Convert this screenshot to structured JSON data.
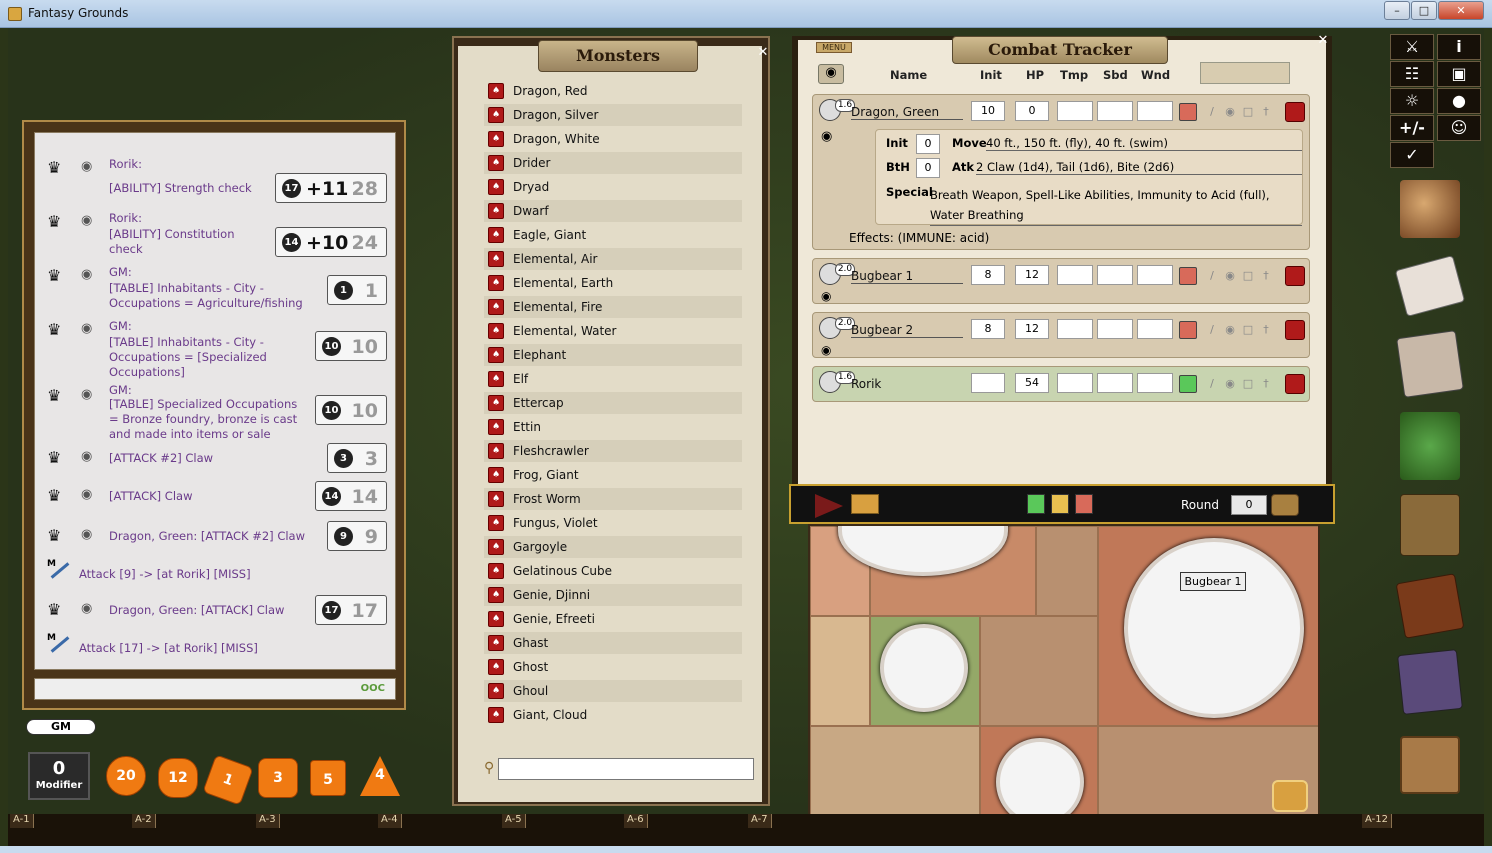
{
  "window": {
    "title": "Fantasy Grounds",
    "btn_min": "–",
    "btn_max": "□",
    "btn_close": "✕"
  },
  "grid_labels": [
    "A-1",
    "A-2",
    "A-3",
    "A-4",
    "A-5",
    "A-6",
    "A-7",
    "A-12"
  ],
  "chat": {
    "messages": [
      {
        "sender": "Rorik:",
        "text": "[ABILITY] Strength check",
        "die": "17",
        "total": "+11",
        "result": "28"
      },
      {
        "sender": "Rorik:",
        "text": "[ABILITY] Constitution check",
        "die": "14",
        "total": "+10",
        "result": "24"
      },
      {
        "sender": "GM:",
        "text": "[TABLE] Inhabitants - City - Occupations = Agriculture/fishing",
        "die": "1",
        "result": "1"
      },
      {
        "sender": "GM:",
        "text": "[TABLE] Inhabitants - City - Occupations = [Specialized Occupations]",
        "die": "10",
        "result": "10"
      },
      {
        "sender": "GM:",
        "text": "[TABLE] Specialized Occupations = Bronze foundry, bronze is cast and made into items or sale",
        "die": "10",
        "result": "10"
      },
      {
        "sender": "",
        "text": "[ATTACK #2] Claw",
        "die": "3",
        "result": "3"
      },
      {
        "sender": "",
        "text": "[ATTACK] Claw",
        "die": "14",
        "result": "14"
      },
      {
        "sender": "",
        "text": "Dragon, Green:  [ATTACK #2] Claw",
        "die": "9",
        "result": "9"
      },
      {
        "log": "Attack [9] -> [at Rorik] [MISS]"
      },
      {
        "sender": "",
        "text": "Dragon, Green:  [ATTACK] Claw",
        "die": "17",
        "result": "17"
      },
      {
        "log": "Attack [17] -> [at Rorik] [MISS]"
      }
    ],
    "ooc_label": "OOC"
  },
  "gm_label": "GM",
  "modifier": {
    "value": "0",
    "label": "Modifier"
  },
  "dice": [
    {
      "name": "d20",
      "label": "20"
    },
    {
      "name": "d12",
      "label": "12"
    },
    {
      "name": "d10",
      "label": "1"
    },
    {
      "name": "d8",
      "label": "3"
    },
    {
      "name": "d6",
      "label": "5"
    },
    {
      "name": "d4",
      "label": "4"
    }
  ],
  "monsters": {
    "title": "Monsters",
    "items": [
      "Dragon, Red",
      "Dragon, Silver",
      "Dragon, White",
      "Drider",
      "Dryad",
      "Dwarf",
      "Eagle, Giant",
      "Elemental, Air",
      "Elemental, Earth",
      "Elemental, Fire",
      "Elemental, Water",
      "Elephant",
      "Elf",
      "Ettercap",
      "Ettin",
      "Fleshcrawler",
      "Frog, Giant",
      "Frost Worm",
      "Fungus, Violet",
      "Gargoyle",
      "Gelatinous Cube",
      "Genie, Djinni",
      "Genie, Efreeti",
      "Ghast",
      "Ghost",
      "Ghoul",
      "Giant, Cloud"
    ],
    "search_value": ""
  },
  "combat_tracker": {
    "title": "Combat Tracker",
    "menu": "MENU",
    "columns": {
      "name": "Name",
      "init": "Init",
      "hp": "HP",
      "tmp": "Tmp",
      "sbd": "Sbd",
      "wnd": "Wnd"
    },
    "entries": [
      {
        "badge": "1.6",
        "name": "Dragon, Green",
        "init": "10",
        "hp": "0",
        "tmp": "",
        "sbd": "",
        "wnd": ""
      },
      {
        "badge": "2.0",
        "name": "Bugbear 1",
        "init": "8",
        "hp": "12",
        "tmp": "",
        "sbd": "",
        "wnd": ""
      },
      {
        "badge": "2.0",
        "name": "Bugbear 2",
        "init": "8",
        "hp": "12",
        "tmp": "",
        "sbd": "",
        "wnd": ""
      },
      {
        "badge": "1.6",
        "name": "Rorik",
        "init": "",
        "hp": "54",
        "tmp": "",
        "sbd": "",
        "wnd": ""
      }
    ],
    "detail": {
      "init_label": "Init",
      "init_value": "0",
      "move_label": "Move",
      "move_value": "40 ft., 150 ft. (fly), 40 ft. (swim)",
      "bth_label": "BtH",
      "bth_value": "0",
      "atk_label": "Atk",
      "atk_value": "2 Claw (1d4), Tail (1d6), Bite (2d6)",
      "special_label": "Special",
      "special_value": "Breath Weapon, Spell-Like Abilities, Immunity to Acid (full), Water Breathing",
      "effects": "Effects: (IMMUNE: acid)"
    },
    "round_label": "Round",
    "round_value": "0"
  },
  "map": {
    "tooltip": "Bugbear 1"
  },
  "sidebar": {
    "buttons": [
      "⚔",
      "i",
      "☷",
      "▣",
      "☼",
      "●",
      "+/-",
      "☺",
      "✓"
    ]
  }
}
